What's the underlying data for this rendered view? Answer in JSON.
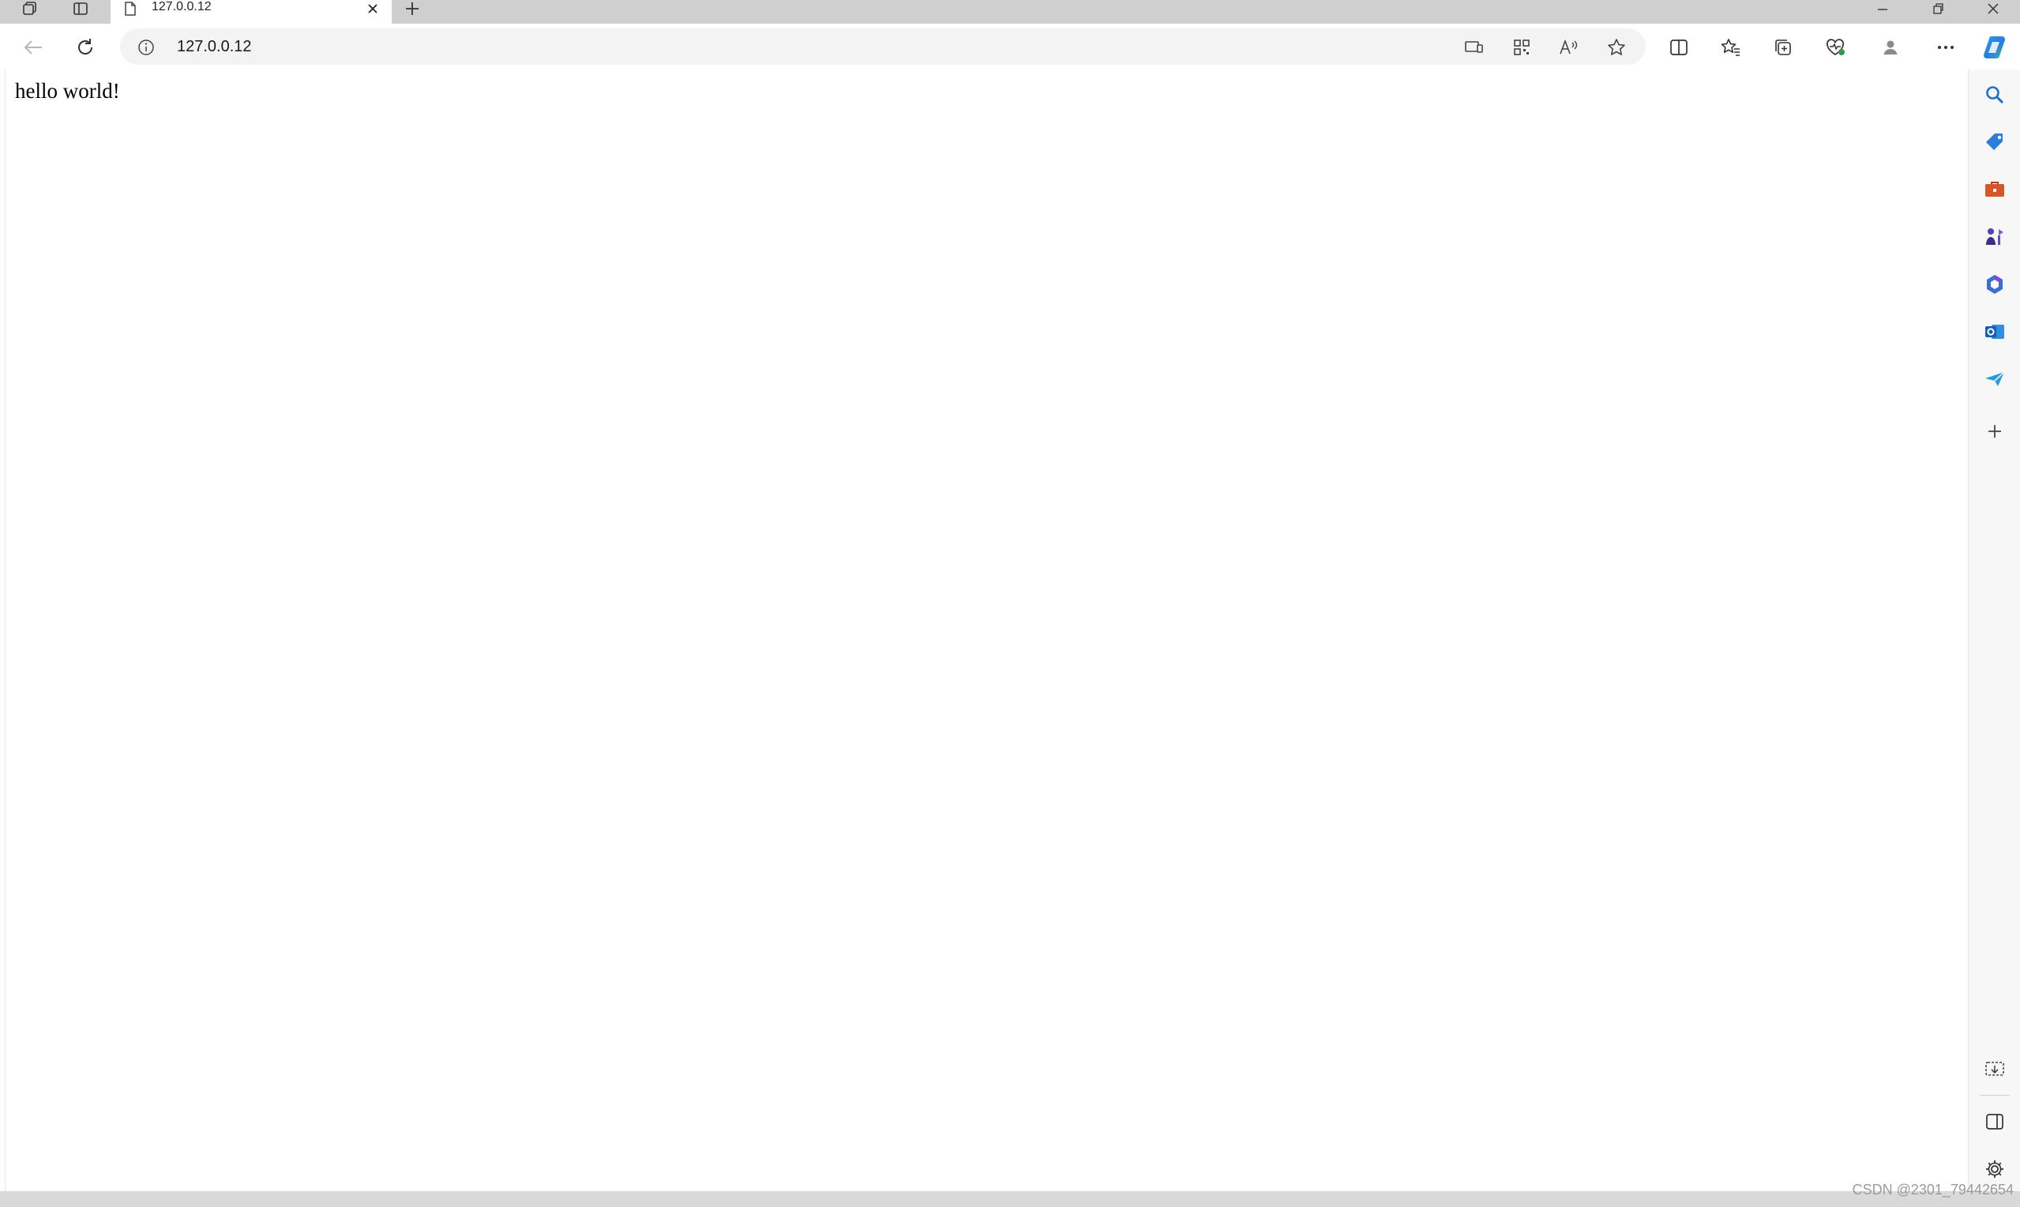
{
  "tab": {
    "title": "127.0.0.12",
    "close_label": "✕"
  },
  "address_bar": {
    "url": "127.0.0.12"
  },
  "page": {
    "body_text": "hello world!"
  },
  "watermark": "CSDN @2301_79442654",
  "colors": {
    "titlebar": "#cfcfcf",
    "toolbar": "#ffffff",
    "address_bg": "#f3f3f3",
    "sidebar_bg": "#f7f7f7",
    "copilot": "#2a7de1"
  }
}
